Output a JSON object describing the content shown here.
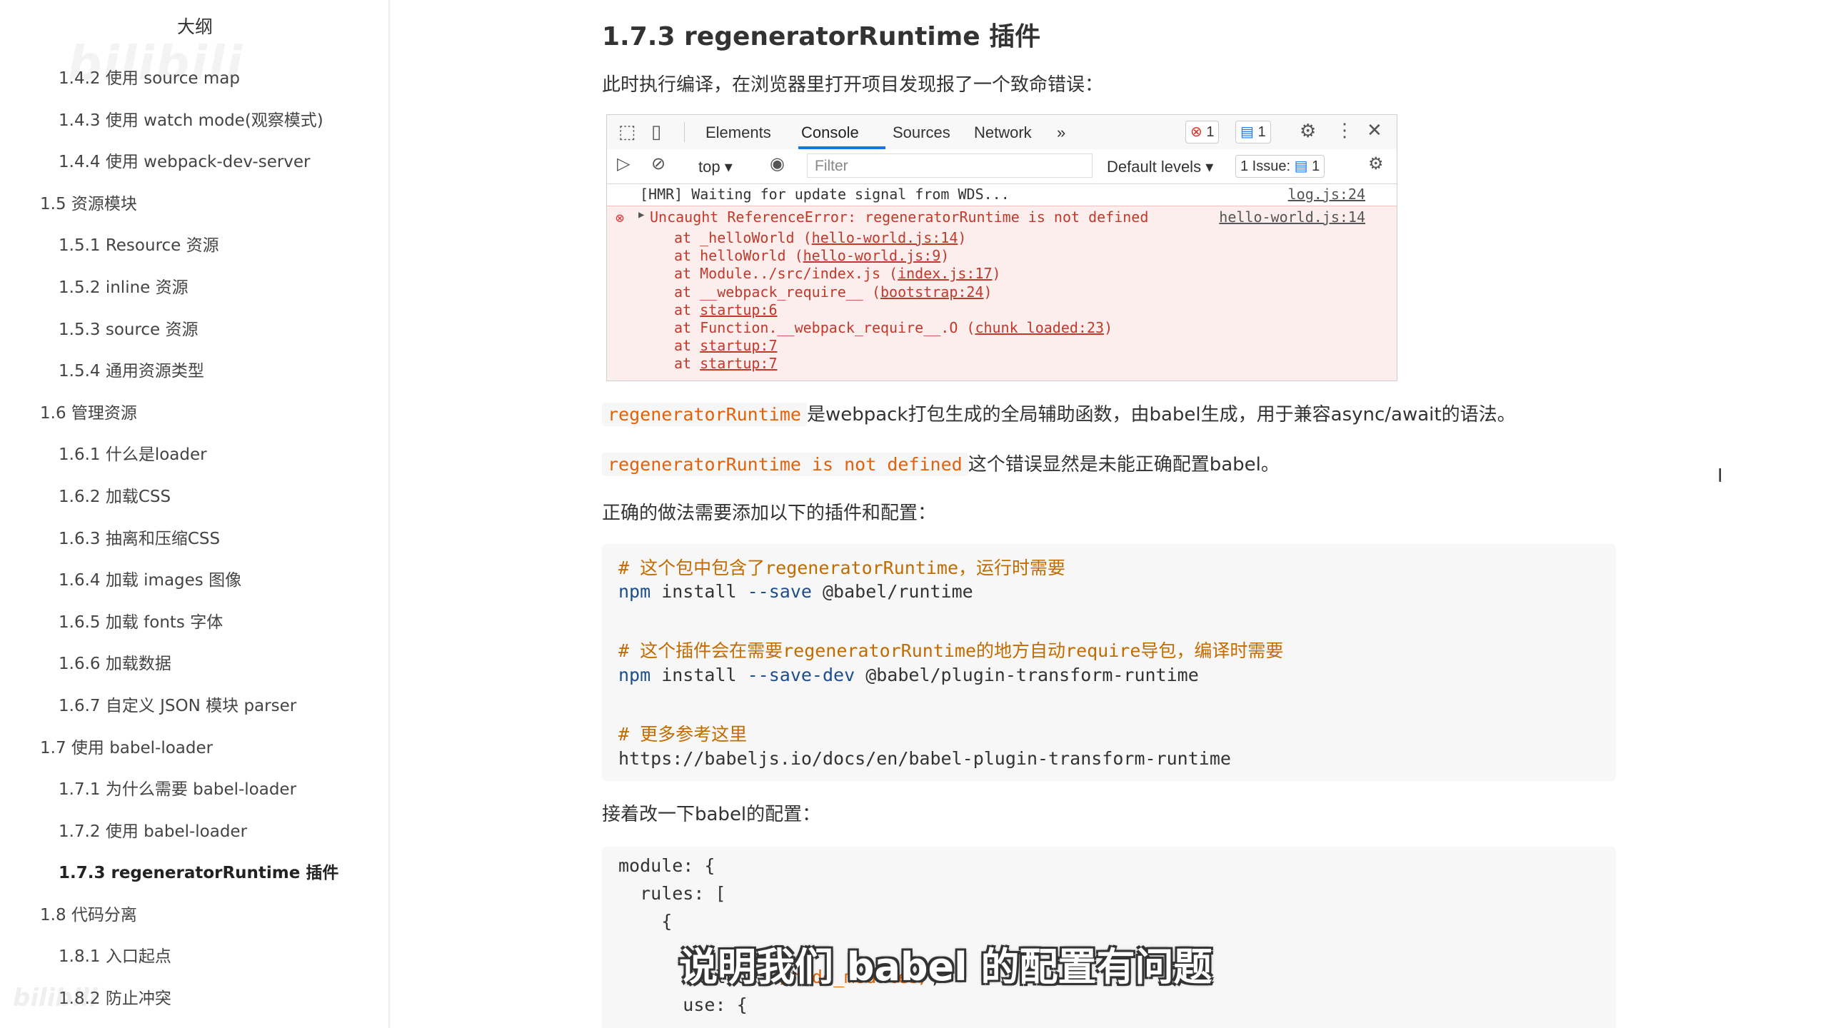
{
  "sidebar": {
    "title": "大纲",
    "items": [
      {
        "label": "1.4.2 使用 source map",
        "level": 3,
        "active": false
      },
      {
        "label": "1.4.3 使用 watch mode(观察模式)",
        "level": 3,
        "active": false
      },
      {
        "label": "1.4.4 使用 webpack-dev-server",
        "level": 3,
        "active": false
      },
      {
        "label": "1.5 资源模块",
        "level": 2,
        "active": false
      },
      {
        "label": "1.5.1 Resource 资源",
        "level": 3,
        "active": false
      },
      {
        "label": "1.5.2 inline 资源",
        "level": 3,
        "active": false
      },
      {
        "label": "1.5.3 source 资源",
        "level": 3,
        "active": false
      },
      {
        "label": "1.5.4 通用资源类型",
        "level": 3,
        "active": false
      },
      {
        "label": "1.6 管理资源",
        "level": 2,
        "active": false
      },
      {
        "label": "1.6.1 什么是loader",
        "level": 3,
        "active": false
      },
      {
        "label": "1.6.2 加载CSS",
        "level": 3,
        "active": false
      },
      {
        "label": "1.6.3 抽离和压缩CSS",
        "level": 3,
        "active": false
      },
      {
        "label": "1.6.4 加载 images 图像",
        "level": 3,
        "active": false
      },
      {
        "label": "1.6.5 加载 fonts 字体",
        "level": 3,
        "active": false
      },
      {
        "label": "1.6.6 加载数据",
        "level": 3,
        "active": false
      },
      {
        "label": "1.6.7 自定义 JSON 模块 parser",
        "level": 3,
        "active": false
      },
      {
        "label": "1.7 使用 babel-loader",
        "level": 2,
        "active": false
      },
      {
        "label": "1.7.1 为什么需要 babel-loader",
        "level": 3,
        "active": false
      },
      {
        "label": "1.7.2 使用 babel-loader",
        "level": 3,
        "active": false
      },
      {
        "label": "1.7.3 regeneratorRuntime 插件",
        "level": 3,
        "active": true
      },
      {
        "label": "1.8 代码分离",
        "level": 2,
        "active": false
      },
      {
        "label": "1.8.1 入口起点",
        "level": 3,
        "active": false
      },
      {
        "label": "1.8.2 防止冲突",
        "level": 3,
        "active": false
      }
    ]
  },
  "watermark": "bilibili",
  "main": {
    "title": "1.7.3 regeneratorRuntime 插件",
    "intro": "此时执行编译，在浏览器里打开项目发现报了一个致命错误：",
    "devtools": {
      "tabs": [
        "Elements",
        "Console",
        "Sources",
        "Network",
        "»"
      ],
      "error_count": "1",
      "message_count": "1",
      "context": "top",
      "filter_placeholder": "Filter",
      "levels": "Default levels",
      "issues": "1 Issue:",
      "issue_count": "1",
      "log_text": "[HMR] Waiting for update signal from WDS...",
      "log_source": "log.js:24",
      "error_message": "Uncaught ReferenceError: regeneratorRuntime is not defined",
      "error_source": "hello-world.js:14",
      "stack": [
        {
          "prefix": "at _helloWorld (",
          "link": "hello-world.js:14",
          "suffix": ")"
        },
        {
          "prefix": "at helloWorld (",
          "link": "hello-world.js:9",
          "suffix": ")"
        },
        {
          "prefix": "at Module../src/index.js (",
          "link": "index.js:17",
          "suffix": ")"
        },
        {
          "prefix": "at __webpack_require__ (",
          "link": "bootstrap:24",
          "suffix": ")"
        },
        {
          "prefix": "at ",
          "link": "startup:6",
          "suffix": ""
        },
        {
          "prefix": "at Function.__webpack_require__.O (",
          "link": "chunk loaded:23",
          "suffix": ")"
        },
        {
          "prefix": "at ",
          "link": "startup:7",
          "suffix": ""
        },
        {
          "prefix": "at ",
          "link": "startup:7",
          "suffix": ""
        }
      ]
    },
    "p1_code": "regeneratorRuntime",
    "p1_text": "是webpack打包生成的全局辅助函数，由babel生成，用于兼容async/await的语法。",
    "p2_code": "regeneratorRuntime is not defined",
    "p2_text": "这个错误显然是未能正确配置babel。",
    "p3": "正确的做法需要添加以下的插件和配置：",
    "code1": {
      "c1": "# 这个包中包含了regeneratorRuntime，运行时需要",
      "l1_cmd": "npm",
      "l1_mid": " install ",
      "l1_flag": "--save",
      "l1_pkg": " @babel/runtime",
      "c2": "# 这个插件会在需要regeneratorRuntime的地方自动require导包，编译时需要",
      "l2_cmd": "npm",
      "l2_mid": " install ",
      "l2_flag": "--save-dev",
      "l2_pkg": " @babel/plugin-transform-runtime",
      "c3": "# 更多参考这里",
      "url": "https://babeljs.io/docs/en/babel-plugin-transform-runtime"
    },
    "p4": "接着改一下babel的配置：",
    "code2": {
      "l1": "module: {",
      "l2": "  rules: [",
      "l3": "    {",
      "l4_key": "      exclude: ",
      "l4_val": "/node_modules/",
      "l4_end": ",",
      "l5": "      use: {"
    }
  },
  "caption": "说明我们 babel 的配置有问题",
  "colors": {
    "inline_code": "#e36209",
    "comment": "#c26c00",
    "keyword": "#1d4e89",
    "error_bg": "#fdeeee",
    "error_text": "#c0392b",
    "devtools_accent": "#1a73e8"
  }
}
